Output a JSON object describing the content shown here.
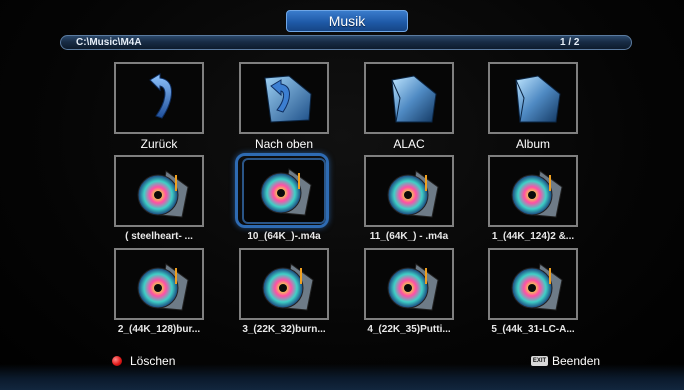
{
  "header": {
    "title": "Musik"
  },
  "path_bar": {
    "path": "C:\\Music\\M4A",
    "page": "1 / 2"
  },
  "grid": {
    "items": [
      {
        "label": "Zurück",
        "icon": "back-arrow-icon",
        "selected": false
      },
      {
        "label": "Nach oben",
        "icon": "folder-up-icon",
        "selected": false
      },
      {
        "label": "ALAC",
        "icon": "folder-icon",
        "selected": false
      },
      {
        "label": "Album",
        "icon": "folder-icon",
        "selected": false
      },
      {
        "label": "( steelheart-       ...",
        "icon": "music-disc-icon",
        "selected": false
      },
      {
        "label": "10_(64K_)-.m4a",
        "icon": "music-disc-icon",
        "selected": true
      },
      {
        "label": "11_(64K_) - .m4a",
        "icon": "music-disc-icon",
        "selected": false
      },
      {
        "label": "1_(44K_124)2 &...",
        "icon": "music-disc-icon",
        "selected": false
      },
      {
        "label": "2_(44K_128)bur...",
        "icon": "music-disc-icon",
        "selected": false
      },
      {
        "label": "3_(22K_32)burn...",
        "icon": "music-disc-icon",
        "selected": false
      },
      {
        "label": "4_(22K_35)Putti...",
        "icon": "music-disc-icon",
        "selected": false
      },
      {
        "label": "5_(44k_31-LC-A...",
        "icon": "music-disc-icon",
        "selected": false
      }
    ]
  },
  "footer": {
    "delete_label": "Löschen",
    "exit_key": "EXIT",
    "exit_label": "Beenden"
  },
  "colors": {
    "accent": "#1f5aa8",
    "selection": "#2e6bb3",
    "frame": "#7f7f7f",
    "delete_dot": "#e21a1a"
  }
}
